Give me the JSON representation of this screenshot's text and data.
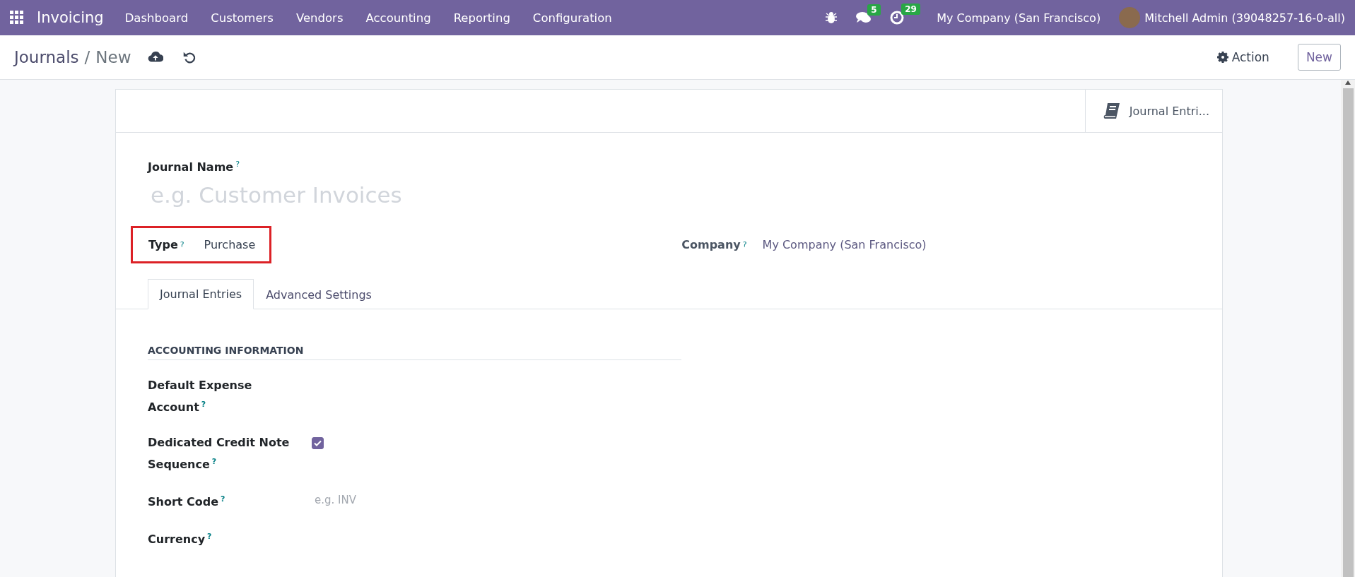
{
  "navbar": {
    "app_name": "Invoicing",
    "menu": [
      "Dashboard",
      "Customers",
      "Vendors",
      "Accounting",
      "Reporting",
      "Configuration"
    ],
    "messages_badge": "5",
    "activities_badge": "29",
    "company": "My Company (San Francisco)",
    "user": "Mitchell Admin (39048257-16-0-all)"
  },
  "control_panel": {
    "breadcrumb": "Journals",
    "separator": "/",
    "current": "New",
    "action_label": "Action",
    "new_button": "New"
  },
  "smart_button": {
    "label": "Journal Entri..."
  },
  "name_field": {
    "label": "Journal Name",
    "help": "?",
    "placeholder": "e.g. Customer Invoices"
  },
  "type_field": {
    "label": "Type",
    "help": "?",
    "value": "Purchase",
    "highlighted": true
  },
  "company_field": {
    "label": "Company",
    "help": "?",
    "value": "My Company (San Francisco)"
  },
  "tabs": [
    {
      "label": "Journal Entries",
      "selected": true
    },
    {
      "label": "Advanced Settings",
      "selected": false
    }
  ],
  "section": {
    "title": "ACCOUNTING INFORMATION",
    "fields": [
      {
        "kind": "text",
        "label_lines": [
          "Default Expense",
          "Account"
        ],
        "help": "?"
      },
      {
        "kind": "checkbox",
        "label_lines": [
          "Dedicated Credit Note",
          "Sequence"
        ],
        "help": "?",
        "checked": true
      },
      {
        "kind": "text",
        "label_lines": [
          "Short Code"
        ],
        "help": "?",
        "placeholder": "e.g. INV"
      },
      {
        "kind": "text",
        "label_lines": [
          "Currency"
        ],
        "help": "?"
      }
    ]
  }
}
